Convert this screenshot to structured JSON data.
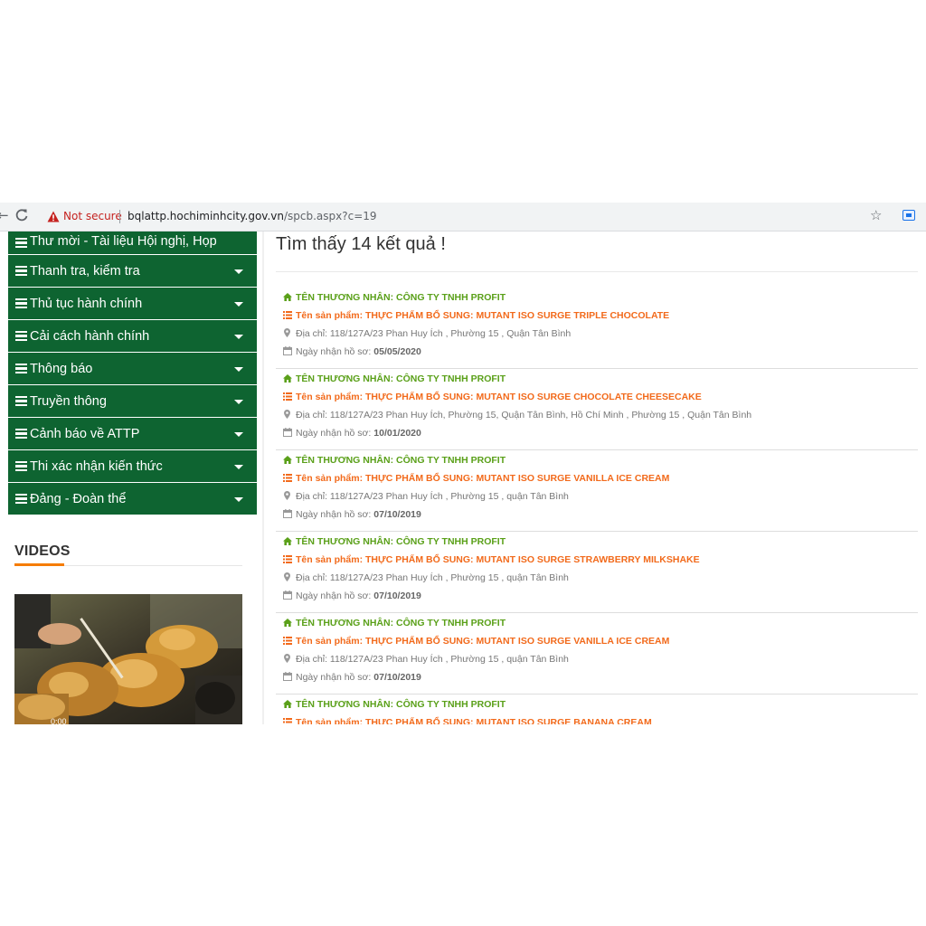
{
  "browser": {
    "security_label": "Not secure",
    "url_host": "bqlattp.hochiminhcity.gov.vn",
    "url_path": "/spcb.aspx?c=19"
  },
  "sidebar": {
    "items": [
      {
        "label": "Thư mời - Tài liệu Hội nghị, Họp"
      },
      {
        "label": "Thanh tra, kiểm tra"
      },
      {
        "label": "Thủ tục hành chính"
      },
      {
        "label": "Cải cách hành chính"
      },
      {
        "label": "Thông báo"
      },
      {
        "label": "Truyền thông"
      },
      {
        "label": "Cảnh báo về ATTP"
      },
      {
        "label": "Thi xác nhận kiến thức"
      },
      {
        "label": "Đảng - Đoàn thể"
      }
    ],
    "videos_title": "VIDEOS",
    "video_time": "0:00"
  },
  "main": {
    "result_count_text": "Tìm thấy 14 kết quả !",
    "results": [
      {
        "merchant": "TÊN THƯƠNG NHÂN: CÔNG TY TNHH PROFIT",
        "product": "Tên sản phẩm: THỰC PHẨM BỔ SUNG: MUTANT ISO SURGE TRIPLE CHOCOLATE",
        "address": "Địa chỉ: 118/127A/23 Phan Huy Ích , Phường 15 , Quận Tân Bình",
        "date_label": "Ngày nhận hồ sơ:",
        "date": "05/05/2020"
      },
      {
        "merchant": "TÊN THƯƠNG NHÂN: CÔNG TY TNHH PROFIT",
        "product": "Tên sản phẩm: THỰC PHẨM BỔ SUNG: MUTANT ISO SURGE CHOCOLATE CHEESECAKE",
        "address": "Địa chỉ: 118/127A/23 Phan Huy Ích, Phường 15, Quận Tân Bình, Hồ Chí Minh , Phường 15 , Quận Tân Bình",
        "date_label": "Ngày nhận hồ sơ:",
        "date": "10/01/2020"
      },
      {
        "merchant": "TÊN THƯƠNG NHÂN: CÔNG TY TNHH PROFIT",
        "product": "Tên sản phẩm: THỰC PHẨM BỔ SUNG: MUTANT ISO SURGE VANILLA ICE CREAM",
        "address": "Địa chỉ: 118/127A/23 Phan Huy Ích , Phường 15 , quận Tân Bình",
        "date_label": "Ngày nhận hồ sơ:",
        "date": "07/10/2019"
      },
      {
        "merchant": "TÊN THƯƠNG NHÂN: CÔNG TY TNHH PROFIT",
        "product": "Tên sản phẩm: THỰC PHẨM BỔ SUNG: MUTANT ISO SURGE STRAWBERRY MILKSHAKE",
        "address": "Địa chỉ: 118/127A/23 Phan Huy Ích , Phường 15 , quận Tân Bình",
        "date_label": "Ngày nhận hồ sơ:",
        "date": "07/10/2019"
      },
      {
        "merchant": "TÊN THƯƠNG NHÂN: CÔNG TY TNHH PROFIT",
        "product": "Tên sản phẩm: THỰC PHẨM BỔ SUNG: MUTANT ISO SURGE VANILLA ICE CREAM",
        "address": "Địa chỉ: 118/127A/23 Phan Huy Ích , Phường 15 , quận Tân Bình",
        "date_label": "Ngày nhận hồ sơ:",
        "date": "07/10/2019"
      },
      {
        "merchant": "TÊN THƯƠNG NHÂN: CÔNG TY TNHH PROFIT",
        "product": "Tên sản phẩm: THỰC PHẨM BỔ SUNG: MUTANT ISO SURGE BANANA CREAM"
      }
    ]
  },
  "colors": {
    "menu_green": "#0e6431",
    "merchant_green": "#5aa019",
    "product_orange": "#f26a1b",
    "accent_orange": "#f57c00",
    "insecure_red": "#c5221f"
  },
  "icons": [
    "reload-icon",
    "warning-icon",
    "star-icon",
    "extension-icon",
    "list-icon",
    "chevron-down-icon",
    "home-icon",
    "map-marker-icon",
    "calendar-icon"
  ]
}
